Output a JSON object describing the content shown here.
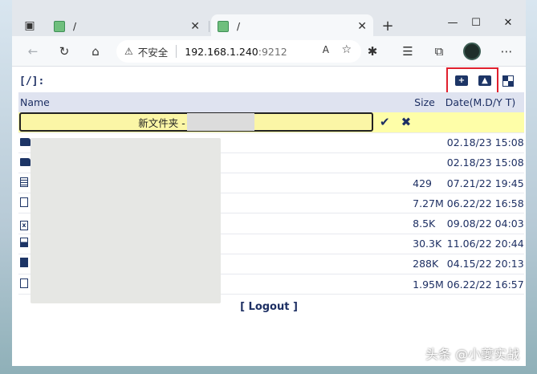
{
  "browser": {
    "tabs": [
      {
        "title": "/",
        "active": false
      },
      {
        "title": "/",
        "active": true
      }
    ],
    "close_glyph": "✕",
    "new_tab_glyph": "+",
    "address": {
      "security_label": "不安全",
      "host": "192.168.1.240",
      "port": ":9212"
    },
    "icons": [
      "tab-actions-icon",
      "back-icon",
      "refresh-icon",
      "home-icon",
      "warning-icon",
      "read-aloud-icon",
      "add-favorite-icon",
      "extensions-icon",
      "favorites-icon",
      "collections-icon",
      "profile-avatar",
      "more-icon"
    ]
  },
  "page": {
    "path": "[/]:",
    "columns": {
      "name": "Name",
      "size": "Size",
      "date": "Date(M.D/Y T)"
    },
    "new_folder_value": "新文件夹 -",
    "confirm_glyph": "✔",
    "cancel_glyph": "✖",
    "files": [
      {
        "type": "folder",
        "size": "",
        "date": "02.18/23 15:08"
      },
      {
        "type": "folder",
        "size": "",
        "date": "02.18/23 15:08"
      },
      {
        "type": "text",
        "size": "429",
        "date": "07.21/22 19:45"
      },
      {
        "type": "doc",
        "size": "7.27M",
        "date": "06.22/22 16:58"
      },
      {
        "type": "excel",
        "size": "8.5K",
        "date": "09.08/22 04:03"
      },
      {
        "type": "image",
        "size": "30.3K",
        "date": "11.06/22 20:44"
      },
      {
        "type": "terminal",
        "size": "288K",
        "date": "04.15/22 20:13"
      },
      {
        "type": "doc",
        "size": "1.95M",
        "date": "06.22/22 16:57"
      }
    ],
    "logout_label": "[ Logout ]"
  },
  "watermark": "头条 @小夔实战",
  "colors": {
    "accent": "#1d2f63",
    "header_bg": "#dfe3f0",
    "new_row_bg": "#fefea8",
    "highlight_border": "#e0202e"
  }
}
